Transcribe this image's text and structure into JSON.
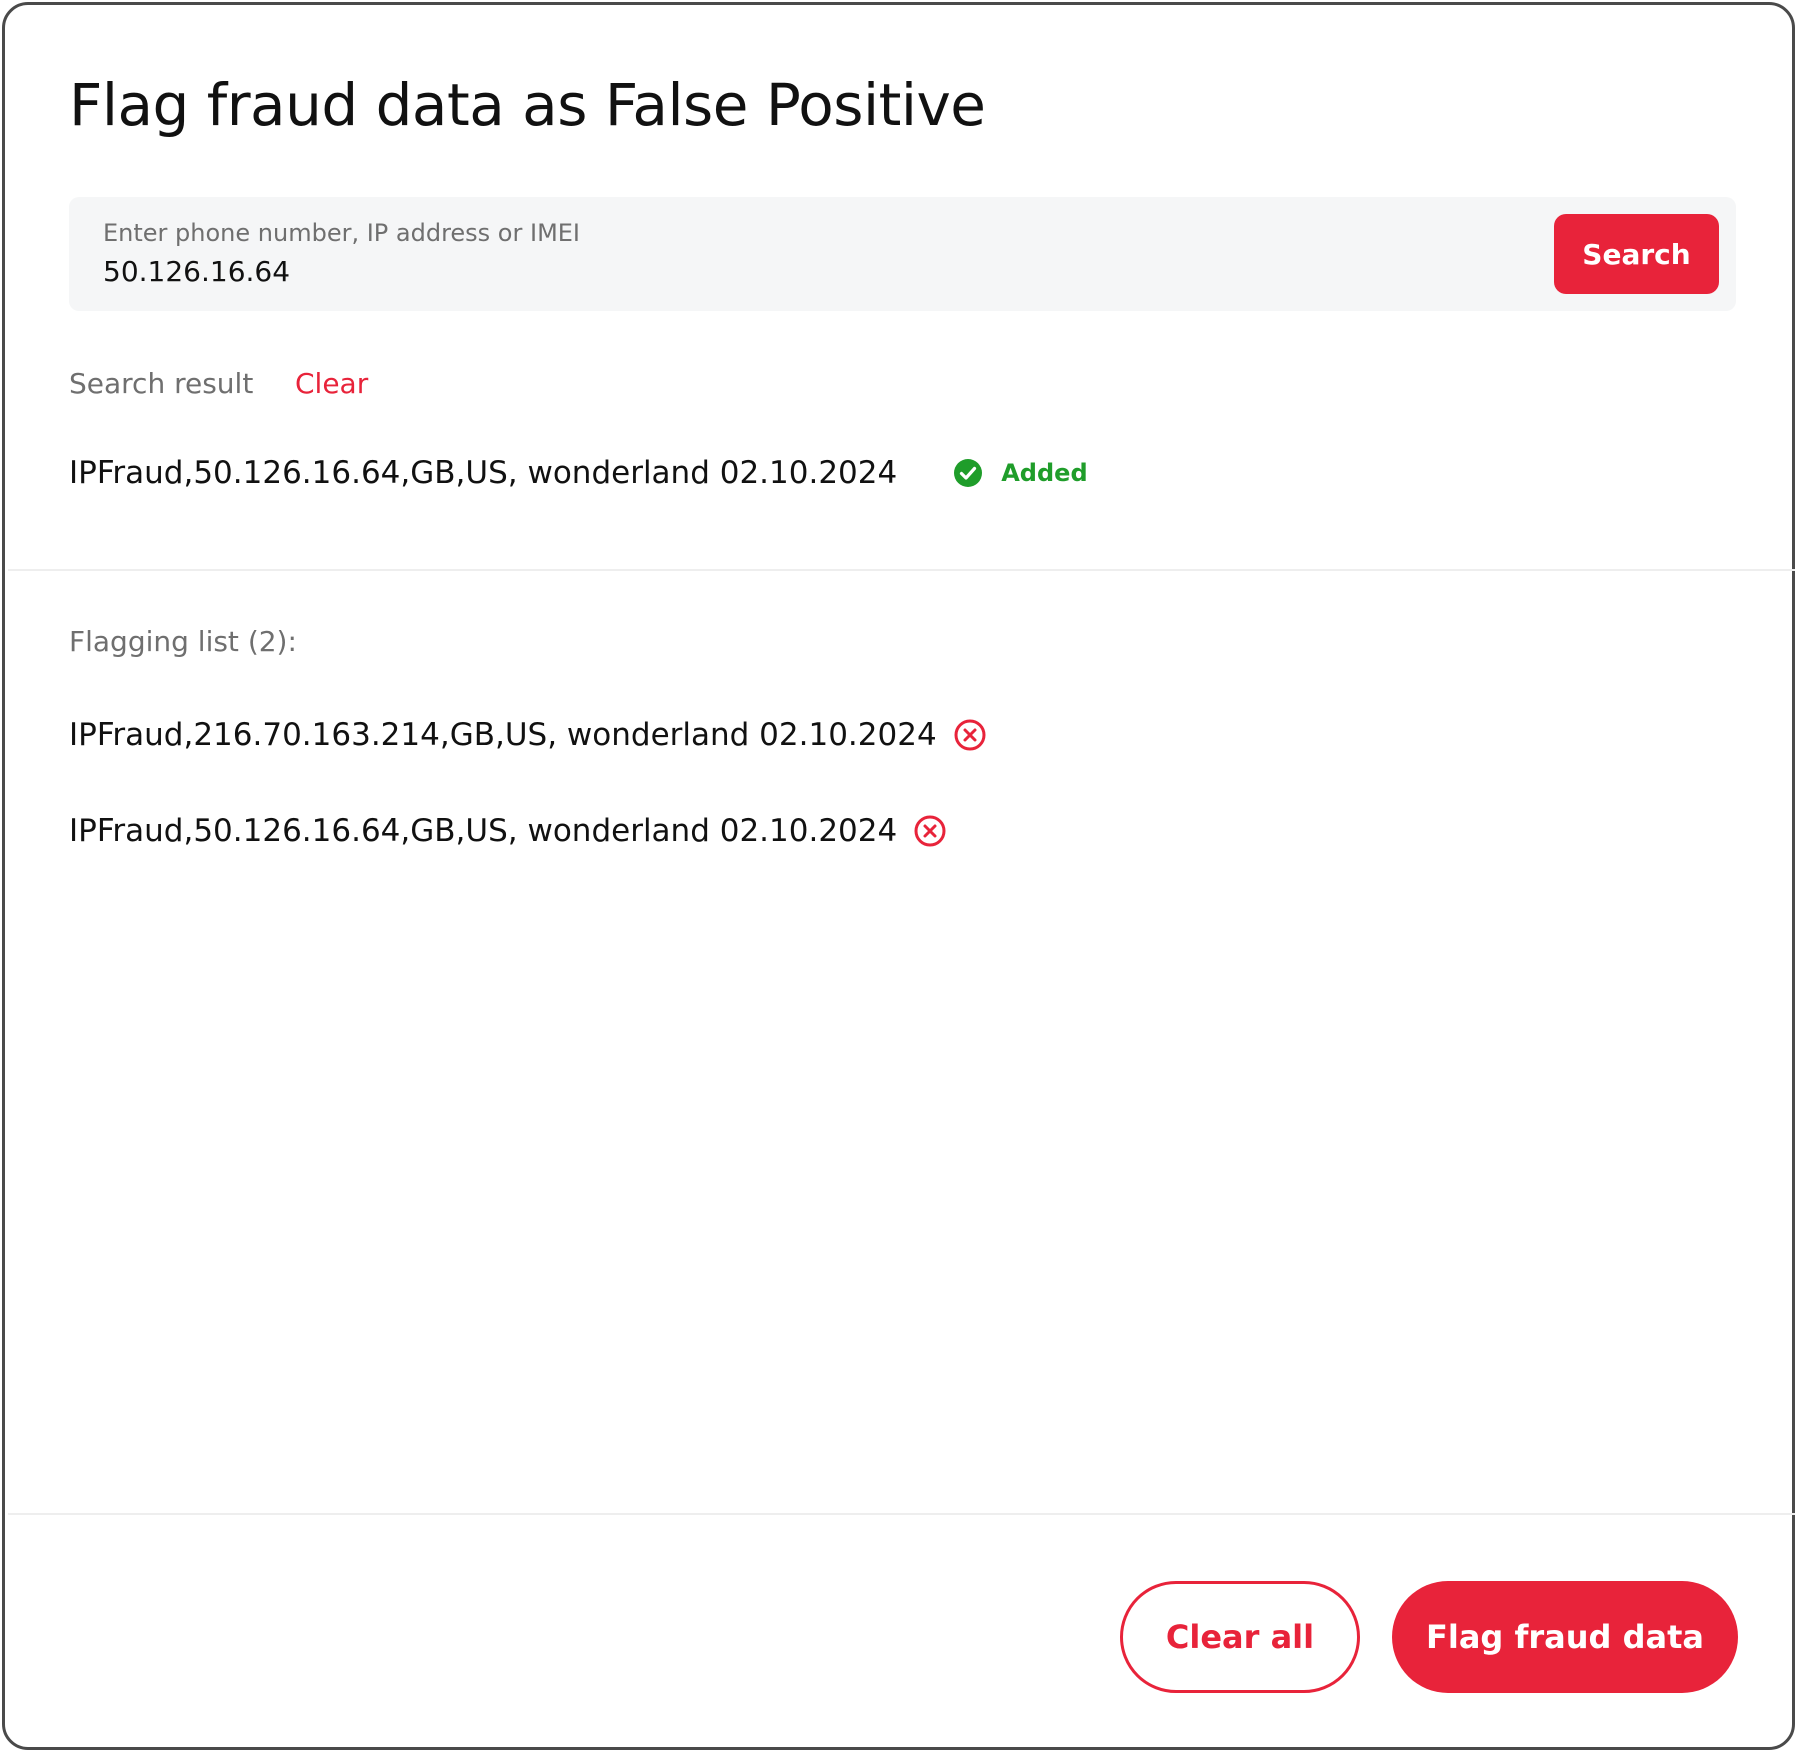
{
  "dialog": {
    "title": "Flag fraud data as False Positive"
  },
  "search": {
    "label": "Enter phone number, IP address or IMEI",
    "value": "50.126.16.64",
    "button_label": "Search"
  },
  "search_result": {
    "label": "Search result",
    "clear_label": "Clear",
    "item": {
      "text": "IPFraud,50.126.16.64,GB,US, wonderland 02.10.2024",
      "status_label": "Added",
      "status_icon": "check-circle-icon"
    }
  },
  "flagging_list": {
    "label": "Flagging list (2):",
    "items": [
      {
        "text": "IPFraud,216.70.163.214,GB,US, wonderland 02.10.2024",
        "remove_icon": "close-circle-icon"
      },
      {
        "text": "IPFraud,50.126.16.64,GB,US, wonderland 02.10.2024",
        "remove_icon": "close-circle-icon"
      }
    ]
  },
  "footer": {
    "clear_all_label": "Clear all",
    "flag_button_label": "Flag fraud data"
  },
  "colors": {
    "accent": "#e8233a",
    "success": "#1f9d2a",
    "muted_text": "#6f6f6f",
    "input_background": "#f5f6f7",
    "border": "#4a4a4a"
  }
}
